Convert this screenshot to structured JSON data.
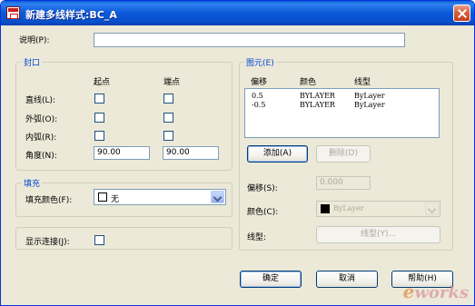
{
  "window": {
    "title": "新建多线样式:BC_A"
  },
  "description": {
    "label": "说明(P):",
    "value": ""
  },
  "caps": {
    "title": "封口",
    "col_start": "起点",
    "col_end": "端点",
    "rows": [
      {
        "label": "直线(L):",
        "start_checked": false,
        "end_checked": false
      },
      {
        "label": "外弧(O):",
        "start_checked": false,
        "end_checked": false
      },
      {
        "label": "内弧(R):",
        "start_checked": false,
        "end_checked": false
      }
    ],
    "angle_label": "角度(N):",
    "angle_start": "90.00",
    "angle_end": "90.00"
  },
  "fill": {
    "title": "填充",
    "color_label": "填充颜色(F):",
    "color_value": "无"
  },
  "joints": {
    "label": "显示连接(J):",
    "checked": false
  },
  "elements": {
    "title": "图元(E)",
    "headers": [
      "偏移",
      "颜色",
      "线型"
    ],
    "rows": [
      {
        "offset": "0.5",
        "color": "BYLAYER",
        "linetype": "ByLayer"
      },
      {
        "offset": "-0.5",
        "color": "BYLAYER",
        "linetype": "ByLayer"
      }
    ],
    "add_label": "添加(A)",
    "delete_label": "删除(D)",
    "offset_label": "偏移(S):",
    "offset_value": "0.000",
    "color_label": "颜色(C):",
    "color_value": "ByLayer",
    "linetype_label": "线型:",
    "linetype_button": "线型(Y)..."
  },
  "footer": {
    "ok": "确定",
    "cancel": "取消",
    "help": "帮助(H)"
  },
  "watermark": {
    "e": "e",
    "rest": "works"
  },
  "colors": {
    "title_bar": "#0a58d8",
    "dialog_bg": "#ece9d8",
    "group_title": "#0046d5",
    "close_button": "#d9603c"
  }
}
